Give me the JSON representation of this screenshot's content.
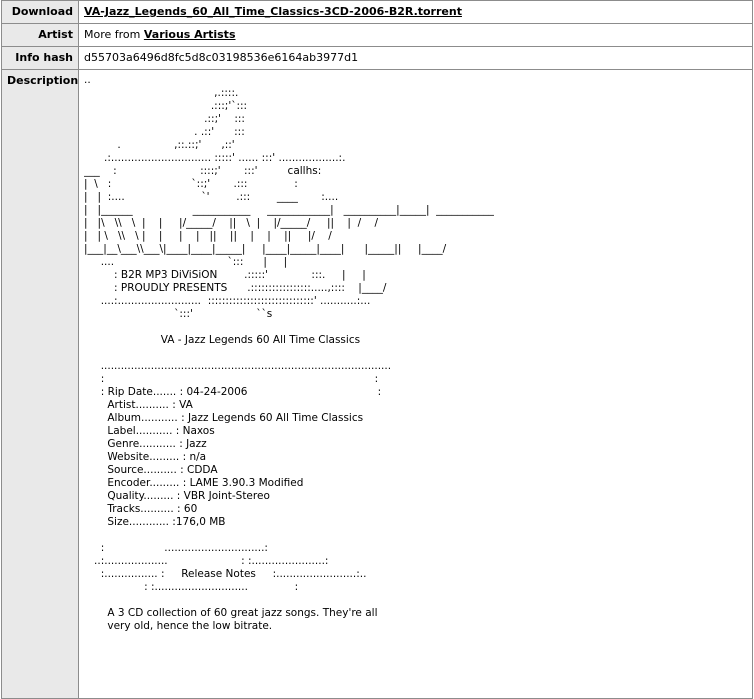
{
  "rows": {
    "download": {
      "label": "Download",
      "link_text": "VA-Jazz_Legends_60_All_Time_Classics-3CD-2006-B2R.torrent"
    },
    "artist": {
      "label": "Artist",
      "prefix": "More from ",
      "link_text": "Various Artists"
    },
    "info_hash": {
      "label": "Info hash",
      "value": "d55703a6496d8fc5d8c03198536e6164ab3977d1"
    },
    "description": {
      "label": "Description",
      "nfo_text": "..\n                                       ,.::::.\n                                      .:::;'`:::\n                                    .::;'    :::\n                                 . .::'      :::\n          .                ,::.::;'      ,::'\n      .:.............................. :::::' ...... :::' ..................:.\n___    :                         ::::;'       :::'         callhs:\n|  \\   :                        `::;'       .:::              :\n|   |  :....                       `'        .:::        ____       :....\n|   |______                  ___________     ____________|   __________|_____|  ___________\n|   |\\   \\\\   \\  |    |     |/_____/    ||   \\  |    |/_____/     ||    |  /    /\n|   | \\   \\\\   \\ |    |     |    |   ||    ||    |    |    ||     |/    /\n|___|__\\___\\\\___\\|____|____|_____|     |____|_____|____|      |_____||     |____/\n     ....                                  `:::      |     |\n         : B2R MP3 DiViSiON        .:::::'             :::.     |     |\n         : PROUDLY PRESENTS      .:::::::::::::::::.....,::::    |____/\n     ....:.........................  ::::::::::::::::::::::::::::::' ...........:...\n                           `:::'                   ``s\n\n                       VA - Jazz Legends 60 All Time Classics\n\n     .......................................................................................\n     :                                                                                 :\n     : Rip Date....... : 04-24-2006                                       :\n       Artist.......... : VA\n       Album........... : Jazz Legends 60 All Time Classics\n       Label........... : Naxos\n       Genre........... : Jazz\n       Website......... : n/a\n       Source.......... : CDDA\n       Encoder......... : LAME 3.90.3 Modified\n       Quality......... : VBR Joint-Stereo\n       Tracks.......... : 60\n       Size............ :176,0 MB\n\n     :                  ..............................:\n   ..:...................                      : :......................:\n     :................ :     Release Notes     :........................:..\n                  : :............................              :\n\n       A 3 CD collection of 60 great jazz songs. They're all\n       very old, hence the low bitrate."
    }
  }
}
